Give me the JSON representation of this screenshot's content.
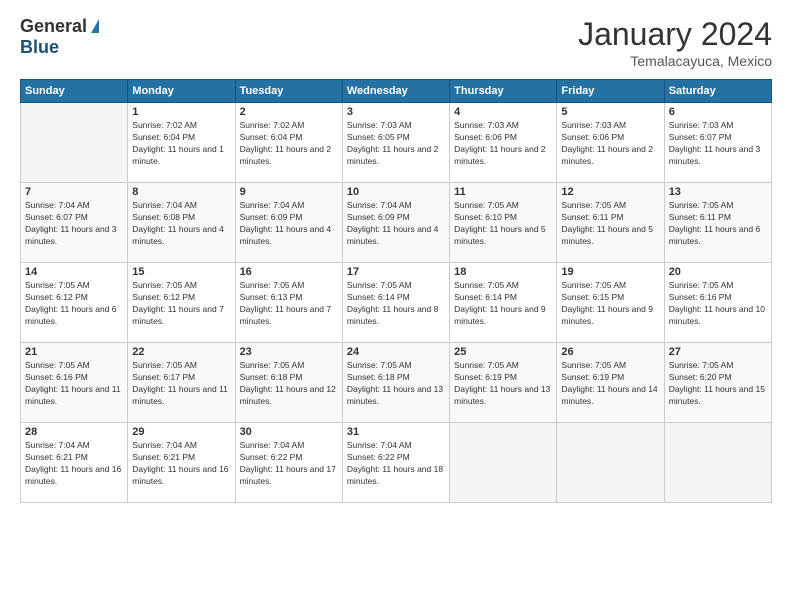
{
  "header": {
    "logo_general": "General",
    "logo_blue": "Blue",
    "month_title": "January 2024",
    "location": "Temalacayuca, Mexico"
  },
  "weekdays": [
    "Sunday",
    "Monday",
    "Tuesday",
    "Wednesday",
    "Thursday",
    "Friday",
    "Saturday"
  ],
  "weeks": [
    [
      {
        "day": "",
        "empty": true
      },
      {
        "day": "1",
        "sunrise": "Sunrise: 7:02 AM",
        "sunset": "Sunset: 6:04 PM",
        "daylight": "Daylight: 11 hours and 1 minute."
      },
      {
        "day": "2",
        "sunrise": "Sunrise: 7:02 AM",
        "sunset": "Sunset: 6:04 PM",
        "daylight": "Daylight: 11 hours and 2 minutes."
      },
      {
        "day": "3",
        "sunrise": "Sunrise: 7:03 AM",
        "sunset": "Sunset: 6:05 PM",
        "daylight": "Daylight: 11 hours and 2 minutes."
      },
      {
        "day": "4",
        "sunrise": "Sunrise: 7:03 AM",
        "sunset": "Sunset: 6:06 PM",
        "daylight": "Daylight: 11 hours and 2 minutes."
      },
      {
        "day": "5",
        "sunrise": "Sunrise: 7:03 AM",
        "sunset": "Sunset: 6:06 PM",
        "daylight": "Daylight: 11 hours and 2 minutes."
      },
      {
        "day": "6",
        "sunrise": "Sunrise: 7:03 AM",
        "sunset": "Sunset: 6:07 PM",
        "daylight": "Daylight: 11 hours and 3 minutes."
      }
    ],
    [
      {
        "day": "7",
        "sunrise": "Sunrise: 7:04 AM",
        "sunset": "Sunset: 6:07 PM",
        "daylight": "Daylight: 11 hours and 3 minutes."
      },
      {
        "day": "8",
        "sunrise": "Sunrise: 7:04 AM",
        "sunset": "Sunset: 6:08 PM",
        "daylight": "Daylight: 11 hours and 4 minutes."
      },
      {
        "day": "9",
        "sunrise": "Sunrise: 7:04 AM",
        "sunset": "Sunset: 6:09 PM",
        "daylight": "Daylight: 11 hours and 4 minutes."
      },
      {
        "day": "10",
        "sunrise": "Sunrise: 7:04 AM",
        "sunset": "Sunset: 6:09 PM",
        "daylight": "Daylight: 11 hours and 4 minutes."
      },
      {
        "day": "11",
        "sunrise": "Sunrise: 7:05 AM",
        "sunset": "Sunset: 6:10 PM",
        "daylight": "Daylight: 11 hours and 5 minutes."
      },
      {
        "day": "12",
        "sunrise": "Sunrise: 7:05 AM",
        "sunset": "Sunset: 6:11 PM",
        "daylight": "Daylight: 11 hours and 5 minutes."
      },
      {
        "day": "13",
        "sunrise": "Sunrise: 7:05 AM",
        "sunset": "Sunset: 6:11 PM",
        "daylight": "Daylight: 11 hours and 6 minutes."
      }
    ],
    [
      {
        "day": "14",
        "sunrise": "Sunrise: 7:05 AM",
        "sunset": "Sunset: 6:12 PM",
        "daylight": "Daylight: 11 hours and 6 minutes."
      },
      {
        "day": "15",
        "sunrise": "Sunrise: 7:05 AM",
        "sunset": "Sunset: 6:12 PM",
        "daylight": "Daylight: 11 hours and 7 minutes."
      },
      {
        "day": "16",
        "sunrise": "Sunrise: 7:05 AM",
        "sunset": "Sunset: 6:13 PM",
        "daylight": "Daylight: 11 hours and 7 minutes."
      },
      {
        "day": "17",
        "sunrise": "Sunrise: 7:05 AM",
        "sunset": "Sunset: 6:14 PM",
        "daylight": "Daylight: 11 hours and 8 minutes."
      },
      {
        "day": "18",
        "sunrise": "Sunrise: 7:05 AM",
        "sunset": "Sunset: 6:14 PM",
        "daylight": "Daylight: 11 hours and 9 minutes."
      },
      {
        "day": "19",
        "sunrise": "Sunrise: 7:05 AM",
        "sunset": "Sunset: 6:15 PM",
        "daylight": "Daylight: 11 hours and 9 minutes."
      },
      {
        "day": "20",
        "sunrise": "Sunrise: 7:05 AM",
        "sunset": "Sunset: 6:16 PM",
        "daylight": "Daylight: 11 hours and 10 minutes."
      }
    ],
    [
      {
        "day": "21",
        "sunrise": "Sunrise: 7:05 AM",
        "sunset": "Sunset: 6:16 PM",
        "daylight": "Daylight: 11 hours and 11 minutes."
      },
      {
        "day": "22",
        "sunrise": "Sunrise: 7:05 AM",
        "sunset": "Sunset: 6:17 PM",
        "daylight": "Daylight: 11 hours and 11 minutes."
      },
      {
        "day": "23",
        "sunrise": "Sunrise: 7:05 AM",
        "sunset": "Sunset: 6:18 PM",
        "daylight": "Daylight: 11 hours and 12 minutes."
      },
      {
        "day": "24",
        "sunrise": "Sunrise: 7:05 AM",
        "sunset": "Sunset: 6:18 PM",
        "daylight": "Daylight: 11 hours and 13 minutes."
      },
      {
        "day": "25",
        "sunrise": "Sunrise: 7:05 AM",
        "sunset": "Sunset: 6:19 PM",
        "daylight": "Daylight: 11 hours and 13 minutes."
      },
      {
        "day": "26",
        "sunrise": "Sunrise: 7:05 AM",
        "sunset": "Sunset: 6:19 PM",
        "daylight": "Daylight: 11 hours and 14 minutes."
      },
      {
        "day": "27",
        "sunrise": "Sunrise: 7:05 AM",
        "sunset": "Sunset: 6:20 PM",
        "daylight": "Daylight: 11 hours and 15 minutes."
      }
    ],
    [
      {
        "day": "28",
        "sunrise": "Sunrise: 7:04 AM",
        "sunset": "Sunset: 6:21 PM",
        "daylight": "Daylight: 11 hours and 16 minutes."
      },
      {
        "day": "29",
        "sunrise": "Sunrise: 7:04 AM",
        "sunset": "Sunset: 6:21 PM",
        "daylight": "Daylight: 11 hours and 16 minutes."
      },
      {
        "day": "30",
        "sunrise": "Sunrise: 7:04 AM",
        "sunset": "Sunset: 6:22 PM",
        "daylight": "Daylight: 11 hours and 17 minutes."
      },
      {
        "day": "31",
        "sunrise": "Sunrise: 7:04 AM",
        "sunset": "Sunset: 6:22 PM",
        "daylight": "Daylight: 11 hours and 18 minutes."
      },
      {
        "day": "",
        "empty": true
      },
      {
        "day": "",
        "empty": true
      },
      {
        "day": "",
        "empty": true
      }
    ]
  ]
}
